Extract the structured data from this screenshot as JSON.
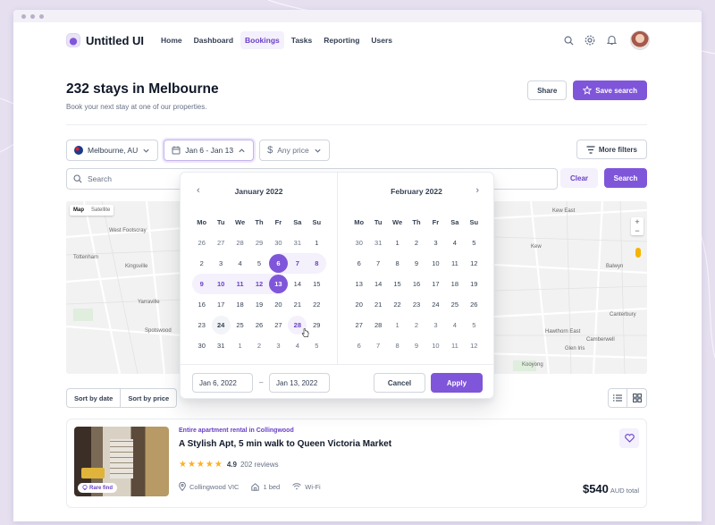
{
  "app": {
    "name": "Untitled UI"
  },
  "nav": {
    "items": [
      {
        "label": "Home",
        "active": false
      },
      {
        "label": "Dashboard",
        "active": false
      },
      {
        "label": "Bookings",
        "active": true
      },
      {
        "label": "Tasks",
        "active": false
      },
      {
        "label": "Reporting",
        "active": false
      },
      {
        "label": "Users",
        "active": false
      }
    ],
    "icons": [
      "search-icon",
      "settings-icon",
      "bell-icon"
    ]
  },
  "header": {
    "title": "232 stays in Melbourne",
    "subtitle": "Book your next stay at one of our properties.",
    "share_label": "Share",
    "save_search_label": "Save search"
  },
  "filters": {
    "location": "Melbourne, AU",
    "dates": "Jan 6 - Jan 13",
    "price": "Any price",
    "more_filters_label": "More filters"
  },
  "search": {
    "placeholder": "Search",
    "clear_label": "Clear",
    "search_label": "Search"
  },
  "map": {
    "map_label": "Map",
    "satellite_label": "Satellite",
    "place_labels": [
      "West Footscray",
      "Tottenham",
      "Kingsville",
      "Yarraville",
      "Spotswood",
      "Kew East",
      "Kew",
      "Balwyn",
      "Canterbury",
      "Hawthorn East",
      "Camberwell",
      "Glen Iris",
      "Kooyong"
    ],
    "zoom_in": "+",
    "zoom_out": "−"
  },
  "datepicker": {
    "months": [
      {
        "title": "January 2022",
        "weekdays": [
          "Mo",
          "Tu",
          "We",
          "Th",
          "Fr",
          "Sa",
          "Su"
        ],
        "weeks": [
          [
            {
              "d": "26",
              "o": true
            },
            {
              "d": "27",
              "o": true
            },
            {
              "d": "28",
              "o": true
            },
            {
              "d": "29",
              "o": true
            },
            {
              "d": "30",
              "o": true
            },
            {
              "d": "31",
              "o": true
            },
            {
              "d": "1"
            }
          ],
          [
            {
              "d": "2"
            },
            {
              "d": "3"
            },
            {
              "d": "4"
            },
            {
              "d": "5"
            },
            {
              "d": "6",
              "s": "start"
            },
            {
              "d": "7",
              "s": "range"
            },
            {
              "d": "8",
              "s": "range-last"
            }
          ],
          [
            {
              "d": "9",
              "s": "range-first"
            },
            {
              "d": "10",
              "s": "range"
            },
            {
              "d": "11",
              "s": "range"
            },
            {
              "d": "12",
              "s": "range"
            },
            {
              "d": "13",
              "s": "end"
            },
            {
              "d": "14"
            },
            {
              "d": "15"
            }
          ],
          [
            {
              "d": "16"
            },
            {
              "d": "17"
            },
            {
              "d": "18"
            },
            {
              "d": "19"
            },
            {
              "d": "20"
            },
            {
              "d": "21"
            },
            {
              "d": "22"
            }
          ],
          [
            {
              "d": "23"
            },
            {
              "d": "24",
              "s": "today"
            },
            {
              "d": "25"
            },
            {
              "d": "26"
            },
            {
              "d": "27"
            },
            {
              "d": "28",
              "s": "hover"
            },
            {
              "d": "29"
            }
          ],
          [
            {
              "d": "30"
            },
            {
              "d": "31"
            },
            {
              "d": "1",
              "o": true
            },
            {
              "d": "2",
              "o": true
            },
            {
              "d": "3",
              "o": true
            },
            {
              "d": "4",
              "o": true
            },
            {
              "d": "5",
              "o": true
            }
          ]
        ]
      },
      {
        "title": "February 2022",
        "weekdays": [
          "Mo",
          "Tu",
          "We",
          "Th",
          "Fr",
          "Sa",
          "Su"
        ],
        "weeks": [
          [
            {
              "d": "30",
              "o": true
            },
            {
              "d": "31",
              "o": true
            },
            {
              "d": "1"
            },
            {
              "d": "2"
            },
            {
              "d": "3"
            },
            {
              "d": "4"
            },
            {
              "d": "5"
            }
          ],
          [
            {
              "d": "6"
            },
            {
              "d": "7"
            },
            {
              "d": "8"
            },
            {
              "d": "9"
            },
            {
              "d": "10"
            },
            {
              "d": "11"
            },
            {
              "d": "12"
            }
          ],
          [
            {
              "d": "13"
            },
            {
              "d": "14"
            },
            {
              "d": "15"
            },
            {
              "d": "16"
            },
            {
              "d": "17"
            },
            {
              "d": "18"
            },
            {
              "d": "19"
            }
          ],
          [
            {
              "d": "20"
            },
            {
              "d": "21"
            },
            {
              "d": "22"
            },
            {
              "d": "23"
            },
            {
              "d": "24"
            },
            {
              "d": "25"
            },
            {
              "d": "26"
            }
          ],
          [
            {
              "d": "27"
            },
            {
              "d": "28"
            },
            {
              "d": "1",
              "o": true
            },
            {
              "d": "2",
              "o": true
            },
            {
              "d": "3",
              "o": true
            },
            {
              "d": "4",
              "o": true
            },
            {
              "d": "5",
              "o": true
            }
          ],
          [
            {
              "d": "6",
              "o": true
            },
            {
              "d": "7",
              "o": true
            },
            {
              "d": "8",
              "o": true
            },
            {
              "d": "9",
              "o": true
            },
            {
              "d": "10",
              "o": true
            },
            {
              "d": "11",
              "o": true
            },
            {
              "d": "12",
              "o": true
            }
          ]
        ]
      }
    ],
    "start_value": "Jan 6, 2022",
    "separator": "–",
    "end_value": "Jan 13, 2022",
    "cancel_label": "Cancel",
    "apply_label": "Apply"
  },
  "sort": {
    "by_date_label": "Sort by date",
    "by_price_label": "Sort by price"
  },
  "listing": {
    "kicker": "Entire apartment rental in Collingwood",
    "title": "A Stylish Apt, 5 min walk to Queen Victoria Market",
    "stars": "★★★★★",
    "rating": "4.9",
    "reviews": "202 reviews",
    "location": "Collingwood VIC",
    "beds": "1 bed",
    "wifi": "Wi-Fi",
    "price": "$540",
    "price_suffix": "AUD total",
    "badge": "Rare find"
  },
  "colors": {
    "brand": "#7f56d9",
    "brand_text": "#6941c6",
    "brand_soft": "#f4f0fc",
    "star": "#fdb022",
    "backdrop": "#e5dff0"
  }
}
